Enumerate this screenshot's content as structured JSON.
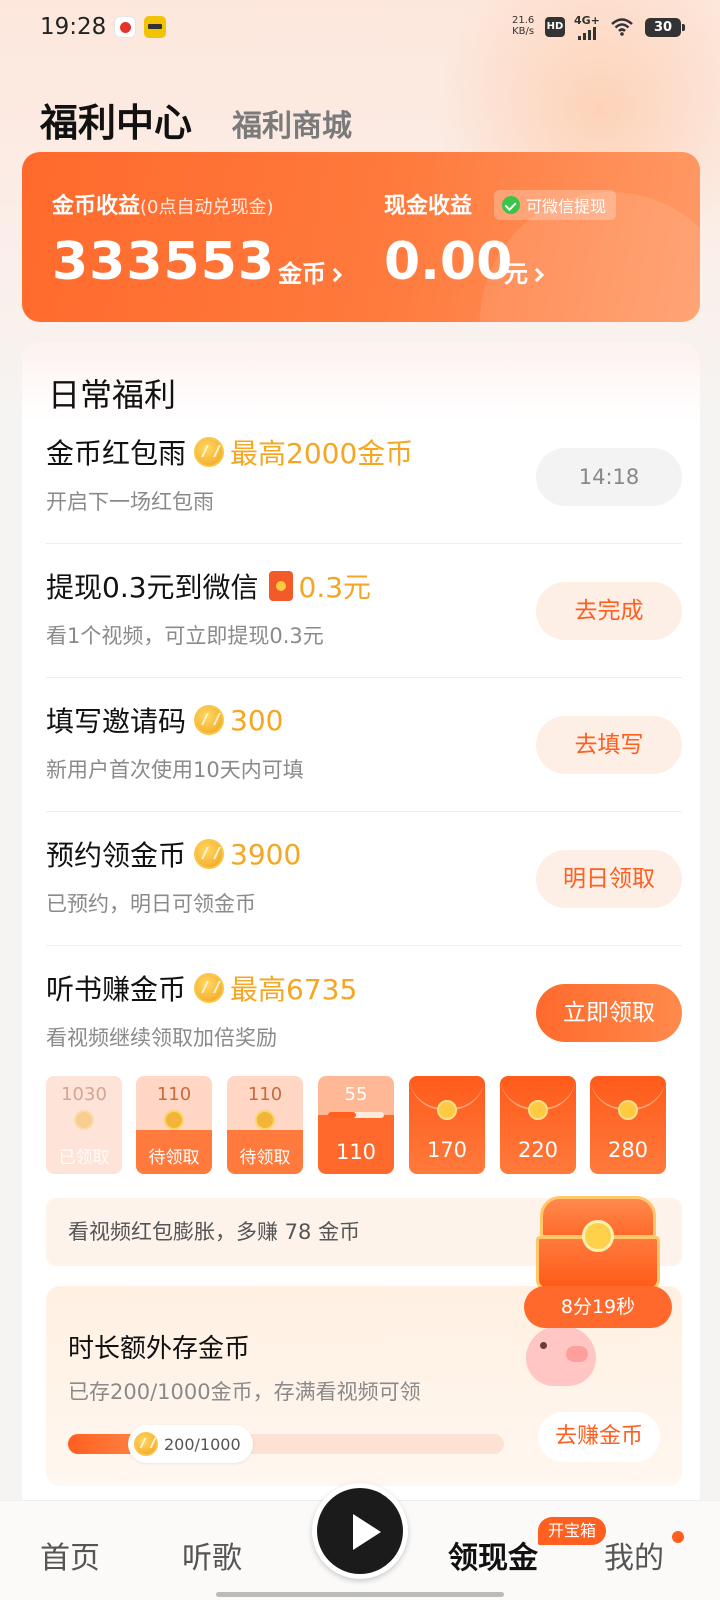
{
  "status_bar": {
    "time": "19:28",
    "net_speed": "21.6",
    "net_unit": "KB/s",
    "hd": "HD",
    "signal": "4G+",
    "battery": "30"
  },
  "header": {
    "tabs": [
      "福利中心",
      "福利商城"
    ]
  },
  "earnings": {
    "coin_title": "金币收益",
    "coin_note": "(0点自动兑现金)",
    "coin_value": "333553",
    "coin_unit": "金币",
    "cash_title": "现金收益",
    "wechat_badge": "可微信提现",
    "cash_value": "0.00",
    "cash_unit": "元"
  },
  "daily": {
    "title": "日常福利",
    "tasks": [
      {
        "title": "金币红包雨",
        "reward": "最高2000金币",
        "sub": "开启下一场红包雨",
        "button": "14:18",
        "icon": "coin-icon"
      },
      {
        "title": "提现0.3元到微信",
        "reward": "0.3元",
        "sub": "看1个视频，可立即提现0.3元",
        "button": "去完成",
        "icon": "red-packet-icon"
      },
      {
        "title": "填写邀请码",
        "reward": "300",
        "sub": "新用户首次使用10天内可填",
        "button": "去填写",
        "icon": "coin-icon"
      },
      {
        "title": "预约领金币",
        "reward": "3900",
        "sub": "已预约，明日可领金币",
        "button": "明日领取",
        "icon": "coin-icon"
      },
      {
        "title": "听书赚金币",
        "reward": "最高6735",
        "sub": "看视频继续领取加倍奖励",
        "button": "立即领取",
        "icon": "coin-icon"
      }
    ],
    "envelopes": [
      {
        "amount": "1030",
        "label": "已领取",
        "state": "done"
      },
      {
        "amount": "110",
        "label": "待领取",
        "state": "wait"
      },
      {
        "amount": "110",
        "label": "待领取",
        "state": "wait"
      },
      {
        "amount": "55",
        "label": "110",
        "state": "now",
        "progress": 0.5
      },
      {
        "amount": "",
        "label": "170",
        "state": "future"
      },
      {
        "amount": "",
        "label": "220",
        "state": "future"
      },
      {
        "amount": "",
        "label": "280",
        "state": "future"
      }
    ],
    "boost_text": "看视频红包膨胀，多赚 78 金币",
    "storage": {
      "title": "时长额外存金币",
      "sub": "已存200/1000金币，存满看视频可领",
      "progress_text": "200/1000",
      "progress": 0.2,
      "button": "去赚金币"
    }
  },
  "chest": {
    "timer": "8分19秒"
  },
  "nav": {
    "items": [
      "首页",
      "听歌",
      "领现金",
      "我的"
    ],
    "badge": "开宝箱",
    "active": "领现金"
  },
  "colors": {
    "accent": "#ff6a2c",
    "reward": "#f5a623"
  }
}
